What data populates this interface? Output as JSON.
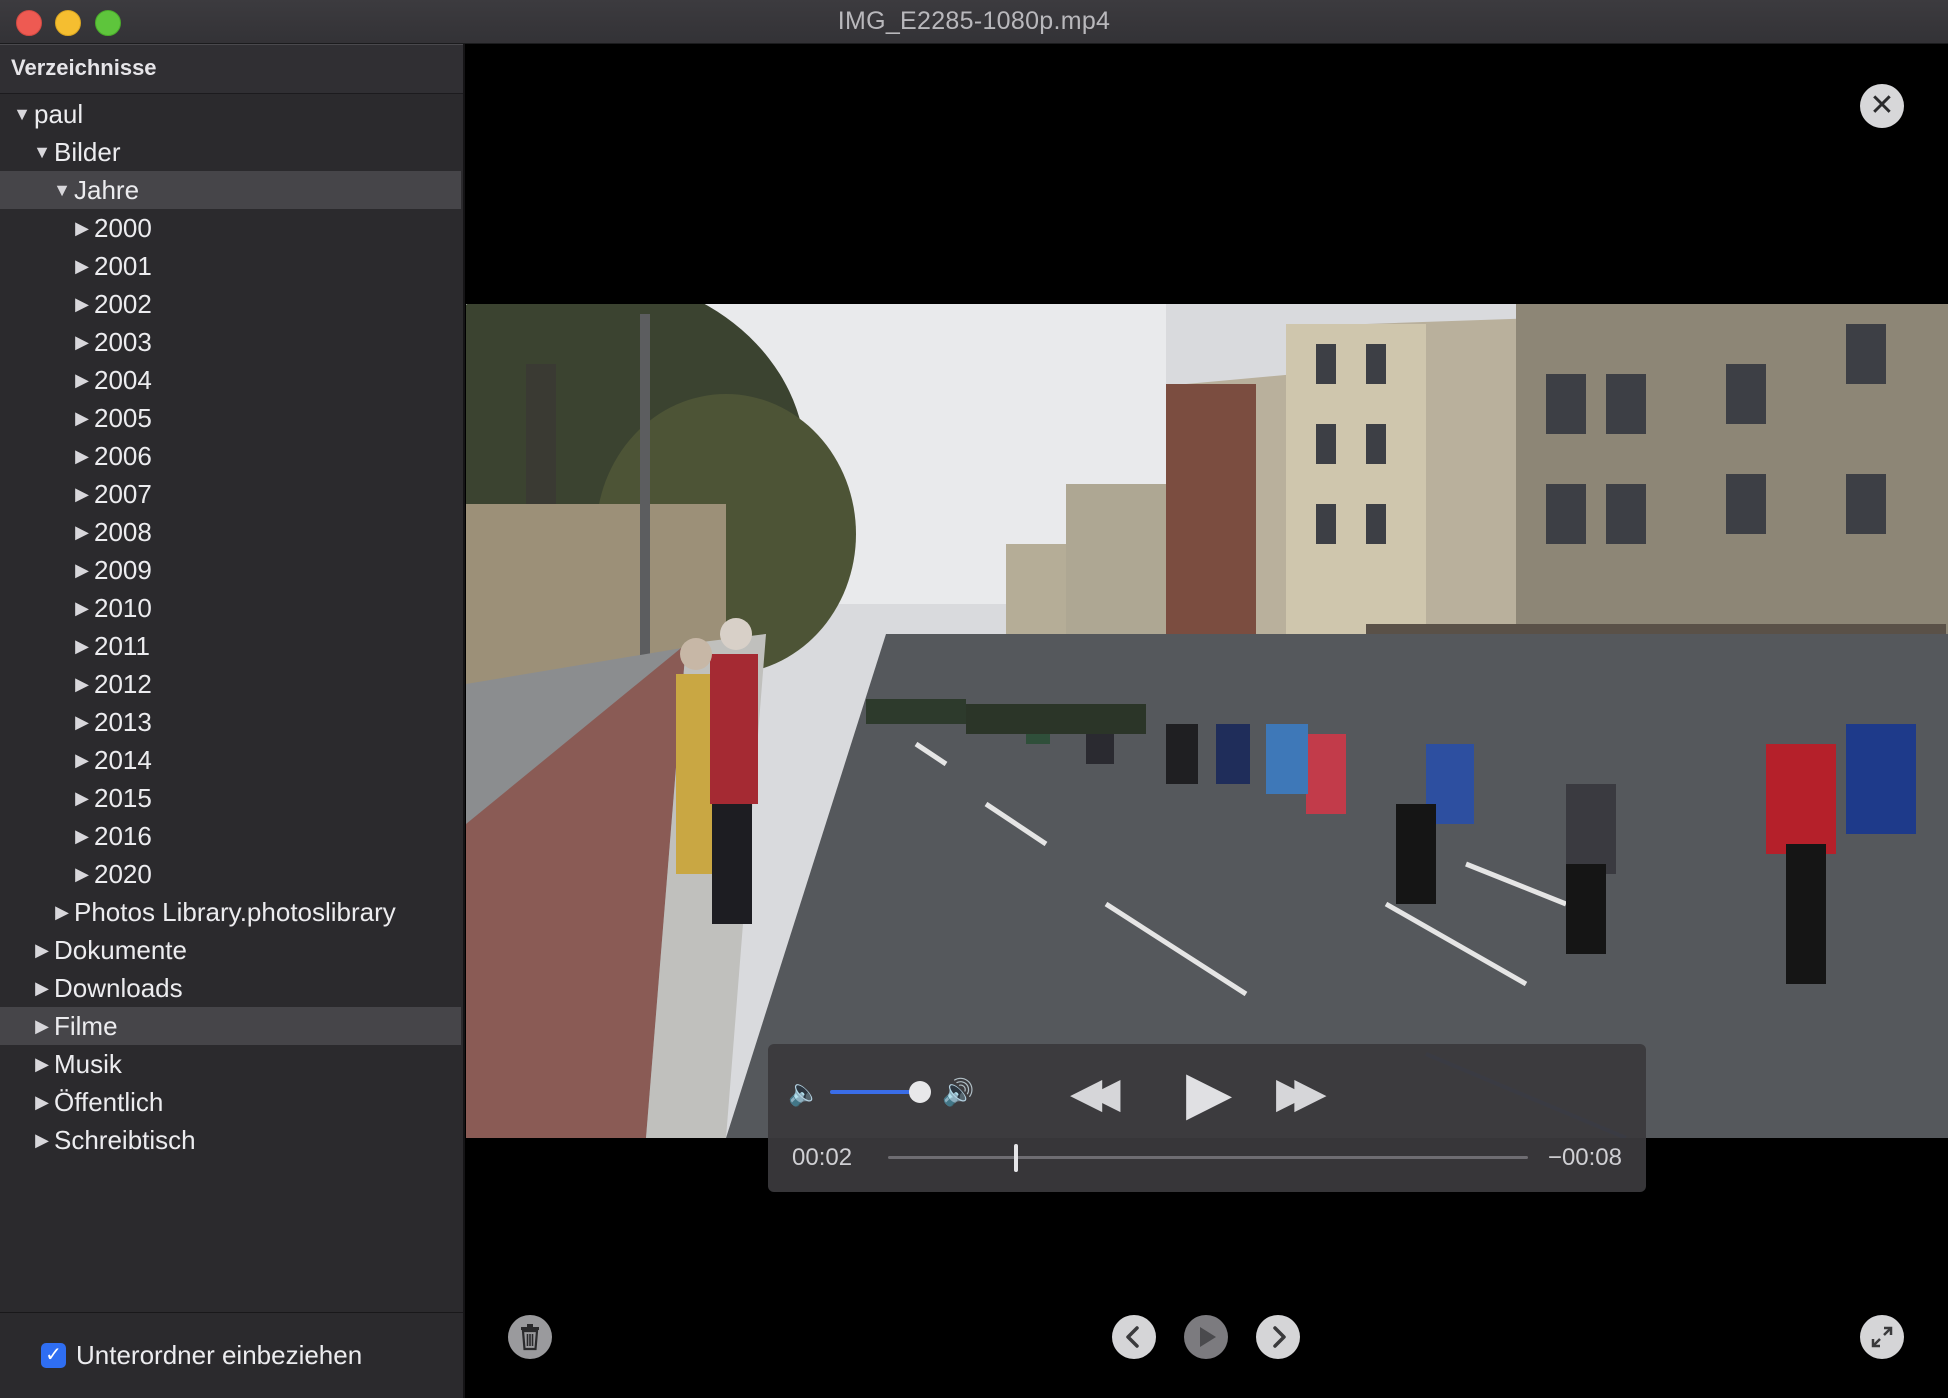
{
  "window": {
    "title": "IMG_E2285-1080p.mp4"
  },
  "sidebar": {
    "header": "Verzeichnisse",
    "tree": [
      {
        "label": "paul",
        "level": 0,
        "expanded": true,
        "selected": false
      },
      {
        "label": "Bilder",
        "level": 1,
        "expanded": true,
        "selected": false
      },
      {
        "label": "Jahre",
        "level": 2,
        "expanded": true,
        "selected": true
      },
      {
        "label": "2000",
        "level": 3,
        "expanded": false,
        "selected": false
      },
      {
        "label": "2001",
        "level": 3,
        "expanded": false,
        "selected": false
      },
      {
        "label": "2002",
        "level": 3,
        "expanded": false,
        "selected": false
      },
      {
        "label": "2003",
        "level": 3,
        "expanded": false,
        "selected": false
      },
      {
        "label": "2004",
        "level": 3,
        "expanded": false,
        "selected": false
      },
      {
        "label": "2005",
        "level": 3,
        "expanded": false,
        "selected": false
      },
      {
        "label": "2006",
        "level": 3,
        "expanded": false,
        "selected": false
      },
      {
        "label": "2007",
        "level": 3,
        "expanded": false,
        "selected": false
      },
      {
        "label": "2008",
        "level": 3,
        "expanded": false,
        "selected": false
      },
      {
        "label": "2009",
        "level": 3,
        "expanded": false,
        "selected": false
      },
      {
        "label": "2010",
        "level": 3,
        "expanded": false,
        "selected": false
      },
      {
        "label": "2011",
        "level": 3,
        "expanded": false,
        "selected": false
      },
      {
        "label": "2012",
        "level": 3,
        "expanded": false,
        "selected": false
      },
      {
        "label": "2013",
        "level": 3,
        "expanded": false,
        "selected": false
      },
      {
        "label": "2014",
        "level": 3,
        "expanded": false,
        "selected": false
      },
      {
        "label": "2015",
        "level": 3,
        "expanded": false,
        "selected": false
      },
      {
        "label": "2016",
        "level": 3,
        "expanded": false,
        "selected": false
      },
      {
        "label": "2020",
        "level": 3,
        "expanded": false,
        "selected": false
      },
      {
        "label": "Photos Library.photoslibrary",
        "level": 2,
        "expanded": false,
        "selected": false
      },
      {
        "label": "Dokumente",
        "level": 1,
        "expanded": false,
        "selected": false
      },
      {
        "label": "Downloads",
        "level": 1,
        "expanded": false,
        "selected": false
      },
      {
        "label": "Filme",
        "level": 1,
        "expanded": false,
        "selected": true
      },
      {
        "label": "Musik",
        "level": 1,
        "expanded": false,
        "selected": false
      },
      {
        "label": "Öffentlich",
        "level": 1,
        "expanded": false,
        "selected": false
      },
      {
        "label": "Schreibtisch",
        "level": 1,
        "expanded": false,
        "selected": false
      }
    ],
    "footer": {
      "checkbox_label": "Unterordner einbeziehen",
      "checked": true
    }
  },
  "player": {
    "current_time": "00:02",
    "remaining_time": "−00:08",
    "progress": 0.2,
    "volume": 1.0
  },
  "icons": {
    "close": "close-icon",
    "trash": "trash-icon",
    "prev": "chevron-left-icon",
    "slideshow": "play-icon",
    "next": "chevron-right-icon",
    "fullscreen": "expand-icon"
  },
  "colors": {
    "accent": "#2f6ef2",
    "sidebar_bg": "#2b2a2d",
    "selected_row": "#464549"
  }
}
